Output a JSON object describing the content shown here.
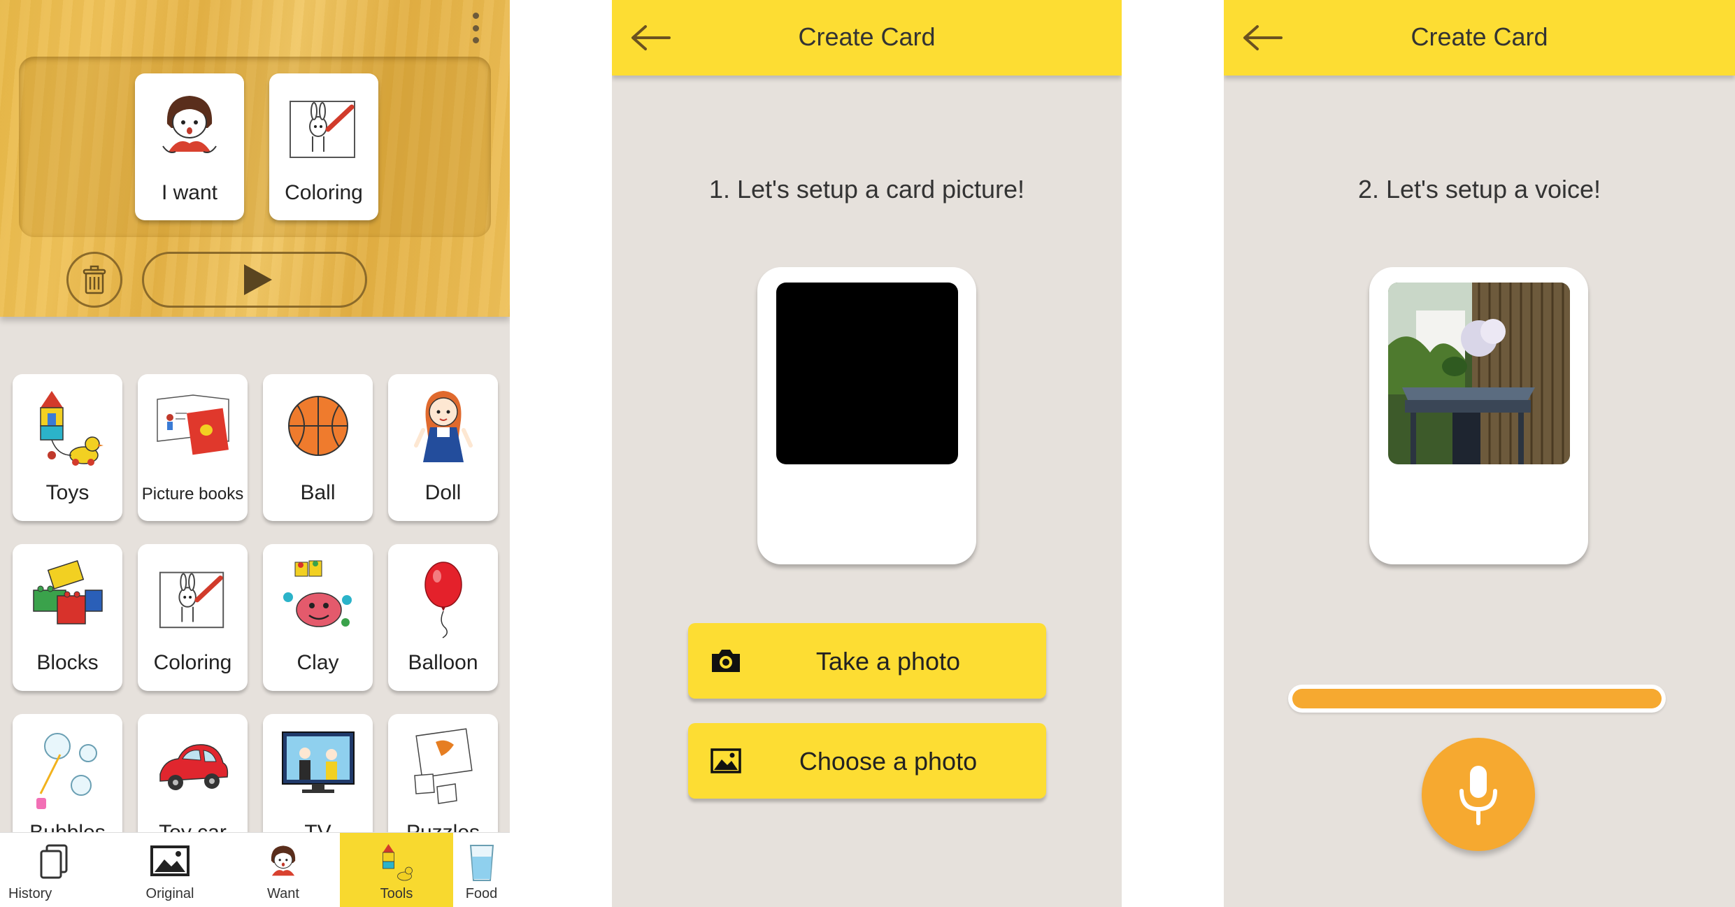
{
  "colors": {
    "accent_yellow": "#fddd33",
    "accent_orange": "#f6a930",
    "panel_bg": "#e6e1dc",
    "wood": "#ecbd52"
  },
  "board": {
    "menu_icon": "vertical-dots-icon",
    "sentence": [
      {
        "label": "I want",
        "icon": "girl-want-icon"
      },
      {
        "label": "Coloring",
        "icon": "rabbit-coloring-icon"
      }
    ],
    "delete_icon": "trash-icon",
    "play_icon": "play-icon"
  },
  "cards": [
    {
      "label": "Toys",
      "icon": "toys-icon"
    },
    {
      "label": "Picture books",
      "icon": "picture-books-icon"
    },
    {
      "label": "Ball",
      "icon": "basketball-icon"
    },
    {
      "label": "Doll",
      "icon": "doll-icon"
    },
    {
      "label": "Blocks",
      "icon": "blocks-icon"
    },
    {
      "label": "Coloring",
      "icon": "rabbit-coloring-icon"
    },
    {
      "label": "Clay",
      "icon": "clay-icon"
    },
    {
      "label": "Balloon",
      "icon": "balloon-icon"
    },
    {
      "label": "Bubbles",
      "icon": "bubbles-icon"
    },
    {
      "label": "Toy car",
      "icon": "toy-car-icon"
    },
    {
      "label": "TV",
      "icon": "tv-icon"
    },
    {
      "label": "Puzzles",
      "icon": "puzzle-icon"
    }
  ],
  "tabs": [
    {
      "label": "History",
      "icon": "history-cards-icon",
      "active": false
    },
    {
      "label": "Original",
      "icon": "image-icon",
      "active": false
    },
    {
      "label": "Want",
      "icon": "girl-want-icon",
      "active": false
    },
    {
      "label": "Tools",
      "icon": "toys-icon",
      "active": true
    },
    {
      "label": "Food",
      "icon": "water-glass-icon",
      "active": false
    }
  ],
  "create_picture": {
    "title": "Create Card",
    "step": "1. Let's setup a card picture!",
    "take_photo": "Take a photo",
    "choose_photo": "Choose a photo"
  },
  "create_voice": {
    "title": "Create Card",
    "step": "2. Let's setup a voice!",
    "recording_progress": 1.0,
    "mic_icon": "microphone-icon"
  }
}
